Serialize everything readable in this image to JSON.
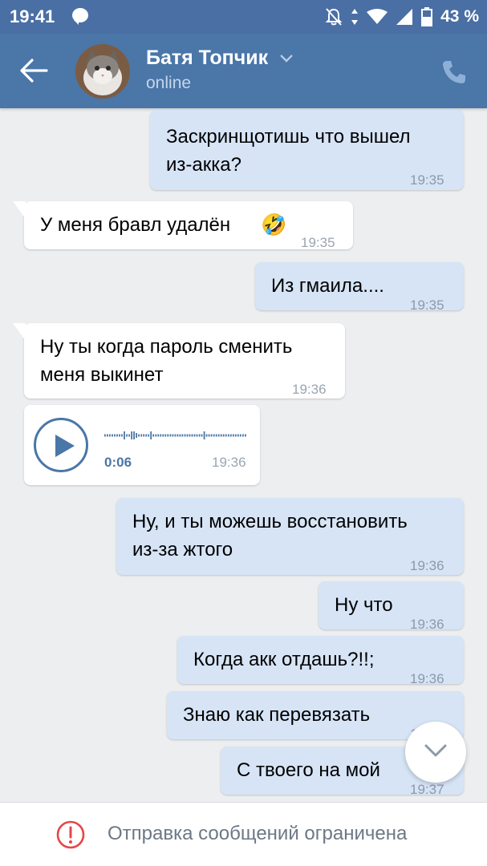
{
  "status_bar": {
    "time": "19:41",
    "battery_percent": "43 %",
    "icons": [
      "chat-notification-icon",
      "bell-off-icon",
      "data-arrows-icon",
      "wifi-icon",
      "cellular-signal-icon",
      "battery-icon"
    ]
  },
  "header": {
    "back_icon": "arrow-left-icon",
    "contact_name": "Батя Топчик",
    "contact_status": "online",
    "chevron_icon": "chevron-down-icon",
    "call_icon": "phone-icon",
    "colors": {
      "appbar": "#4a76a8",
      "statusbar": "#4a6fa5"
    }
  },
  "messages": [
    {
      "dir": "out",
      "text": "Заскринщотишь что вышел\nиз-акка?",
      "time": "19:35"
    },
    {
      "dir": "in",
      "text": "У меня бравл удалён",
      "emoji": "🤣",
      "time": "19:35"
    },
    {
      "dir": "out",
      "text": "Из гмаила....",
      "time": "19:35"
    },
    {
      "dir": "in",
      "text": "Ну ты когда пароль сменить\nменя выкинет",
      "time": "19:36"
    },
    {
      "dir": "in",
      "type": "voice",
      "duration": "0:06",
      "time": "19:36"
    },
    {
      "dir": "out",
      "text": "Ну, и ты можешь восстановить\nиз-за жтого",
      "time": "19:36"
    },
    {
      "dir": "out",
      "text": "Ну что",
      "time": "19:36"
    },
    {
      "dir": "out",
      "text": "Когда акк отдашь?!!;",
      "time": "19:36"
    },
    {
      "dir": "out",
      "text": "Знаю как перевязать",
      "time": "19:37"
    },
    {
      "dir": "out",
      "text": "С твоего на мой",
      "time": "19:37"
    }
  ],
  "scroll_button_icon": "chevron-down-icon",
  "footer": {
    "warning_icon": "exclamation-circle-icon",
    "text": "Отправка сообщений ограничена",
    "warning_color": "#e64646"
  }
}
